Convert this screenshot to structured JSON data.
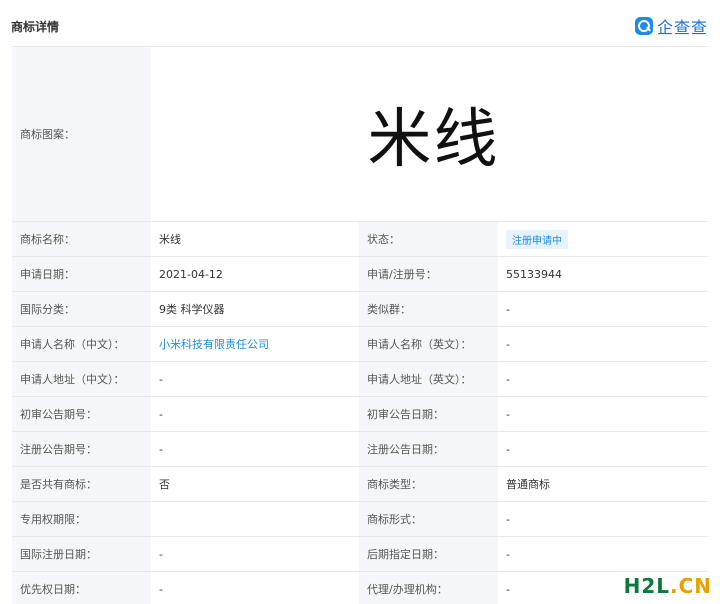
{
  "header": {
    "title": "商标详情",
    "brand_text": "企查查"
  },
  "mark_image": {
    "label": "商标图案：",
    "text": "米线"
  },
  "rows": [
    {
      "l1": "商标名称：",
      "v1": "米线",
      "l2": "状态：",
      "v2": "注册申请中"
    },
    {
      "l1": "申请日期：",
      "v1": "2021-04-12",
      "l2": "申请/注册号：",
      "v2": "55133944"
    },
    {
      "l1": "国际分类：",
      "v1": "9类 科学仪器",
      "l2": "类似群：",
      "v2": "-"
    },
    {
      "l1": "申请人名称（中文）：",
      "v1": "小米科技有限责任公司",
      "l2": "申请人名称（英文）：",
      "v2": "-"
    },
    {
      "l1": "申请人地址（中文）：",
      "v1": "-",
      "l2": "申请人地址（英文）：",
      "v2": "-"
    },
    {
      "l1": "初审公告期号：",
      "v1": "-",
      "l2": "初审公告日期：",
      "v2": "-"
    },
    {
      "l1": "注册公告期号：",
      "v1": "-",
      "l2": "注册公告日期：",
      "v2": "-"
    },
    {
      "l1": "是否共有商标：",
      "v1": "否",
      "l2": "商标类型：",
      "v2": "普通商标"
    },
    {
      "l1": "专用权期限：",
      "v1": "",
      "l2": "商标形式：",
      "v2": "-"
    },
    {
      "l1": "国际注册日期：",
      "v1": "-",
      "l2": "后期指定日期：",
      "v2": "-"
    },
    {
      "l1": "优先权日期：",
      "v1": "-",
      "l2": "代理/办理机构：",
      "v2": "-"
    }
  ],
  "watermark": {
    "part1": "H2L",
    "part2": ".CN"
  },
  "colors": {
    "label_bg": "#f4f6fa",
    "link": "#1e8ce6",
    "badge_bg": "#e6f2fd",
    "brand": "#1e6fd6"
  }
}
